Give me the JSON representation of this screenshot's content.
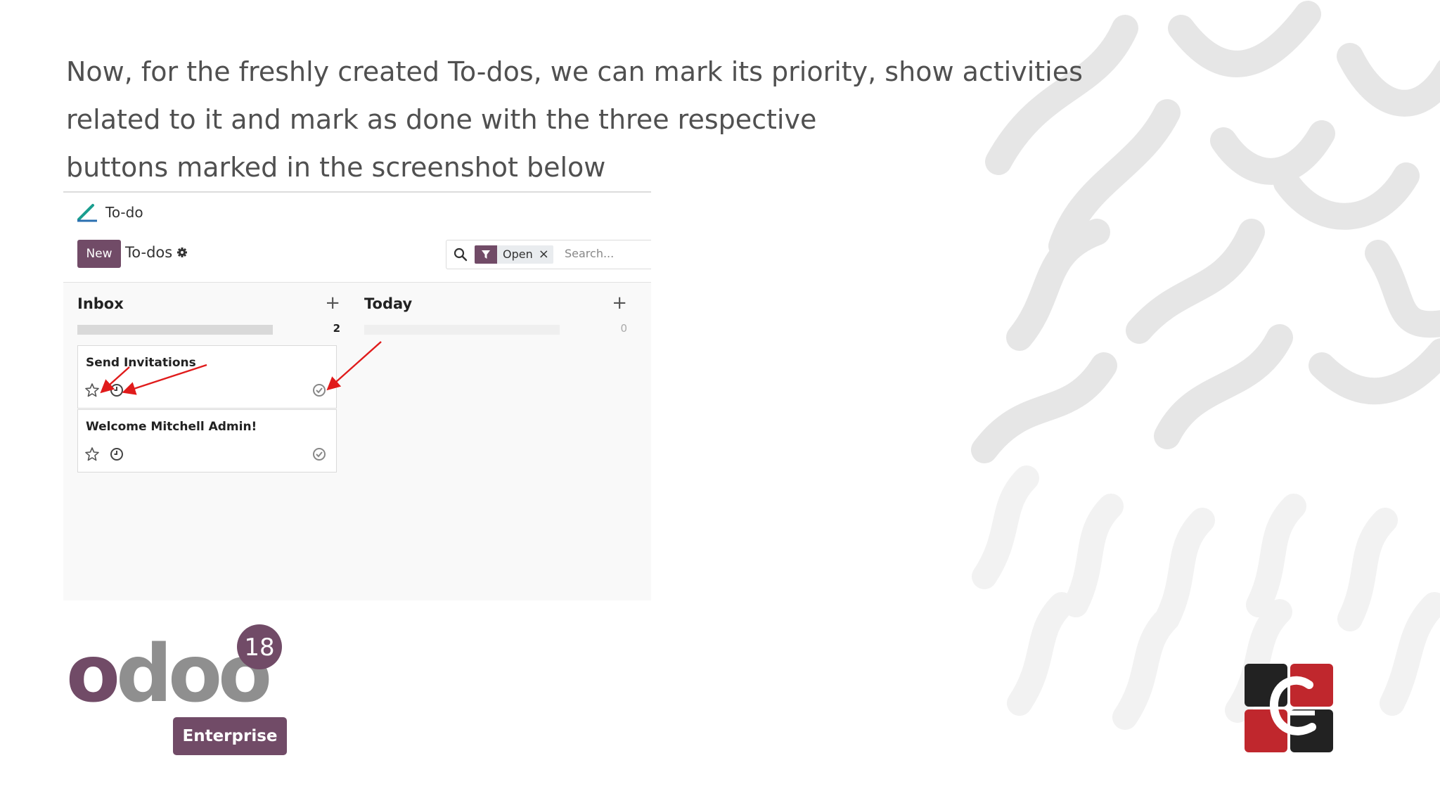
{
  "slide": {
    "heading_lines": [
      "Now, for the freshly created To-dos, we can mark its priority, show activities",
      "related to it and mark as done with the three respective",
      "buttons marked in the screenshot below"
    ]
  },
  "screenshot": {
    "app_name": "To-do",
    "new_button": "New",
    "breadcrumb": "To-dos",
    "search": {
      "facet_label": "Open",
      "facet_close": "×",
      "placeholder": "Search..."
    },
    "columns": [
      {
        "title": "Inbox",
        "add": "+",
        "count": "2",
        "progress": 1.0,
        "cards": [
          {
            "title": "Send Invitations"
          },
          {
            "title": "Welcome Mitchell Admin!"
          }
        ]
      },
      {
        "title": "Today",
        "add": "+",
        "count": "0",
        "progress": 0,
        "cards": []
      }
    ],
    "annotation_arrows_color": "#e01b1b"
  },
  "logos": {
    "odoo_text": "odoo",
    "version_badge": "18",
    "edition": "Enterprise",
    "brand_color": "#714b67",
    "partner_logo_colors": [
      "#222222",
      "#c0272d"
    ]
  }
}
